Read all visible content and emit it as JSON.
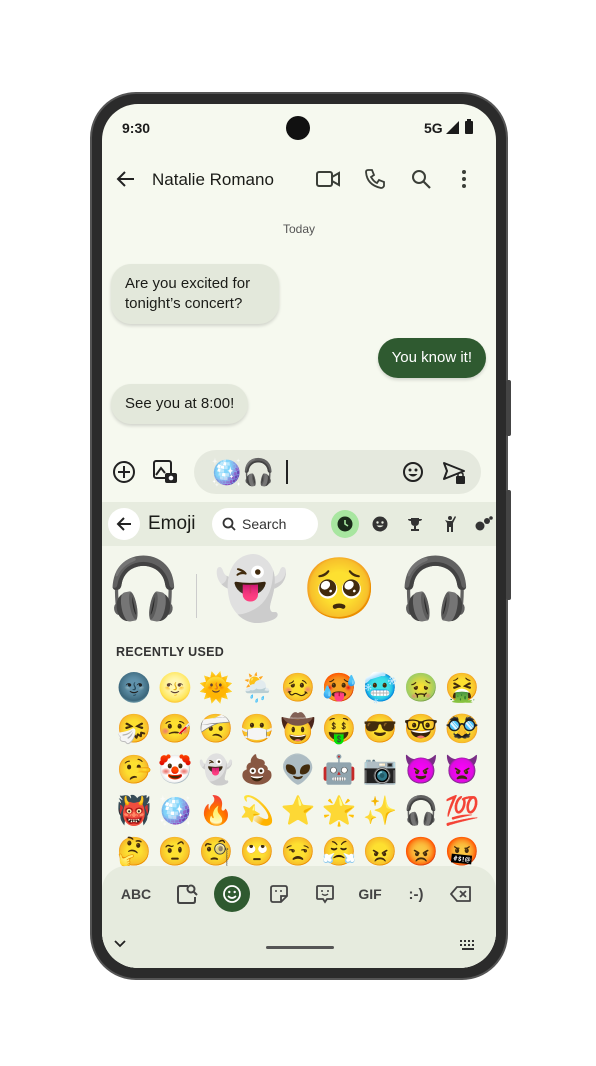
{
  "status": {
    "time": "9:30",
    "network": "5G"
  },
  "header": {
    "contact": "Natalie Romano",
    "icons": [
      "arrow-back",
      "video",
      "phone",
      "search",
      "more-vert"
    ]
  },
  "conversation": {
    "date": "Today",
    "messages": [
      {
        "direction": "incoming",
        "text": "Are you excited for tonight’s concert?"
      },
      {
        "direction": "outgoing",
        "text": "You know it!"
      },
      {
        "direction": "incoming",
        "text": "See you at 8:00!"
      }
    ]
  },
  "compose": {
    "value": "🪩🎧"
  },
  "emoji_panel": {
    "title": "Emoji",
    "search_placeholder": "Search",
    "categories": [
      "recent",
      "smileys",
      "activities",
      "people",
      "nature"
    ],
    "suggestions": [
      "🎧",
      "👻",
      "🥺",
      "🎧"
    ],
    "section": "RECENTLY USED",
    "recent": [
      [
        "🌚",
        "🌝",
        "🌞",
        "🌦️",
        "🥴",
        "🥵",
        "🥶",
        "🤢",
        "🤮"
      ],
      [
        "🤧",
        "🤒",
        "🤕",
        "😷",
        "🤠",
        "🤑",
        "😎",
        "🤓",
        "🥸"
      ],
      [
        "🤥",
        "🤡",
        "👻",
        "💩",
        "👽",
        "🤖",
        "📷",
        "😈",
        "👿"
      ],
      [
        "👹",
        "🪩",
        "🔥",
        "💫",
        "⭐",
        "🌟",
        "✨",
        "🎧",
        "💯"
      ],
      [
        "🤔",
        "🤨",
        "🧐",
        "🙄",
        "😒",
        "😤",
        "😠",
        "😡",
        "🤬"
      ]
    ]
  },
  "toolbar": {
    "abc": "ABC",
    "gif": "GIF",
    "emoticon": ":-)"
  },
  "colors": {
    "accent": "#2f5a30",
    "active_category": "#a8e6a0",
    "screen_bg": "#f6f9ef"
  }
}
